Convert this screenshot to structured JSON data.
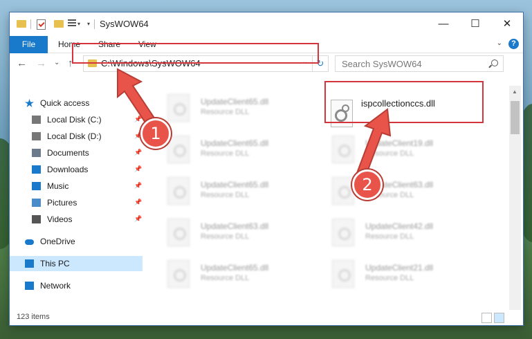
{
  "window": {
    "title": "SysWOW64"
  },
  "titlebar": {
    "minimize_glyph": "—",
    "maximize_glyph": "☐",
    "close_glyph": "✕",
    "qa_dropdown_glyph": "▾",
    "qa_customize_glyph": "▾"
  },
  "ribbon": {
    "tabs": [
      "File",
      "Home",
      "Share",
      "View"
    ],
    "expand_glyph": "⌄",
    "help_glyph": "?"
  },
  "nav": {
    "back_glyph": "←",
    "forward_glyph": "→",
    "recent_glyph": "⌄",
    "up_glyph": "↑",
    "address": "C:\\Windows\\SysWOW64",
    "address_dropdown_glyph": "⌄",
    "refresh_glyph": "↻",
    "search_placeholder": "Search SysWOW64"
  },
  "sidebar": {
    "items": [
      {
        "label": "Quick access",
        "icon": "star-icon"
      },
      {
        "label": "Local Disk (C:)",
        "icon": "drive-icon"
      },
      {
        "label": "Local Disk (D:)",
        "icon": "drive-icon"
      },
      {
        "label": "Documents",
        "icon": "documents-icon"
      },
      {
        "label": "Downloads",
        "icon": "download-icon"
      },
      {
        "label": "Music",
        "icon": "music-icon"
      },
      {
        "label": "Pictures",
        "icon": "pictures-icon"
      },
      {
        "label": "Videos",
        "icon": "videos-icon"
      },
      {
        "label": "OneDrive",
        "icon": "cloud-icon"
      },
      {
        "label": "This PC",
        "icon": "pc-icon"
      },
      {
        "label": "Network",
        "icon": "network-icon"
      }
    ],
    "pin_glyph": "📌"
  },
  "files": {
    "highlighted": {
      "name": "ispcollectionccs.dll"
    },
    "left_column": [
      {
        "name": "UpdateClient65.dll",
        "type": "Resource DLL"
      },
      {
        "name": "UpdateClient65.dll",
        "type": "Resource DLL"
      },
      {
        "name": "UpdateClient65.dll",
        "type": "Resource DLL"
      },
      {
        "name": "UpdateClient63.dll",
        "type": "Resource DLL"
      },
      {
        "name": "UpdateClient65.dll",
        "type": "Resource DLL"
      }
    ],
    "right_column": [
      {
        "name": "UpdateClient19.dll",
        "type": "Resource DLL"
      },
      {
        "name": "UpdateClient63.dll",
        "type": "Resource DLL"
      },
      {
        "name": "UpdateClient42.dll",
        "type": "Resource DLL"
      },
      {
        "name": "UpdateClient21.dll",
        "type": "Resource DLL"
      }
    ]
  },
  "scroll": {
    "up_glyph": "▲",
    "down_glyph": "▼"
  },
  "status": {
    "item_count": "123 items"
  },
  "callouts": {
    "step1": "1",
    "step2": "2"
  },
  "colors": {
    "accent": "#1979ca",
    "highlight": "#d4343a",
    "callout": "#e8544a"
  }
}
